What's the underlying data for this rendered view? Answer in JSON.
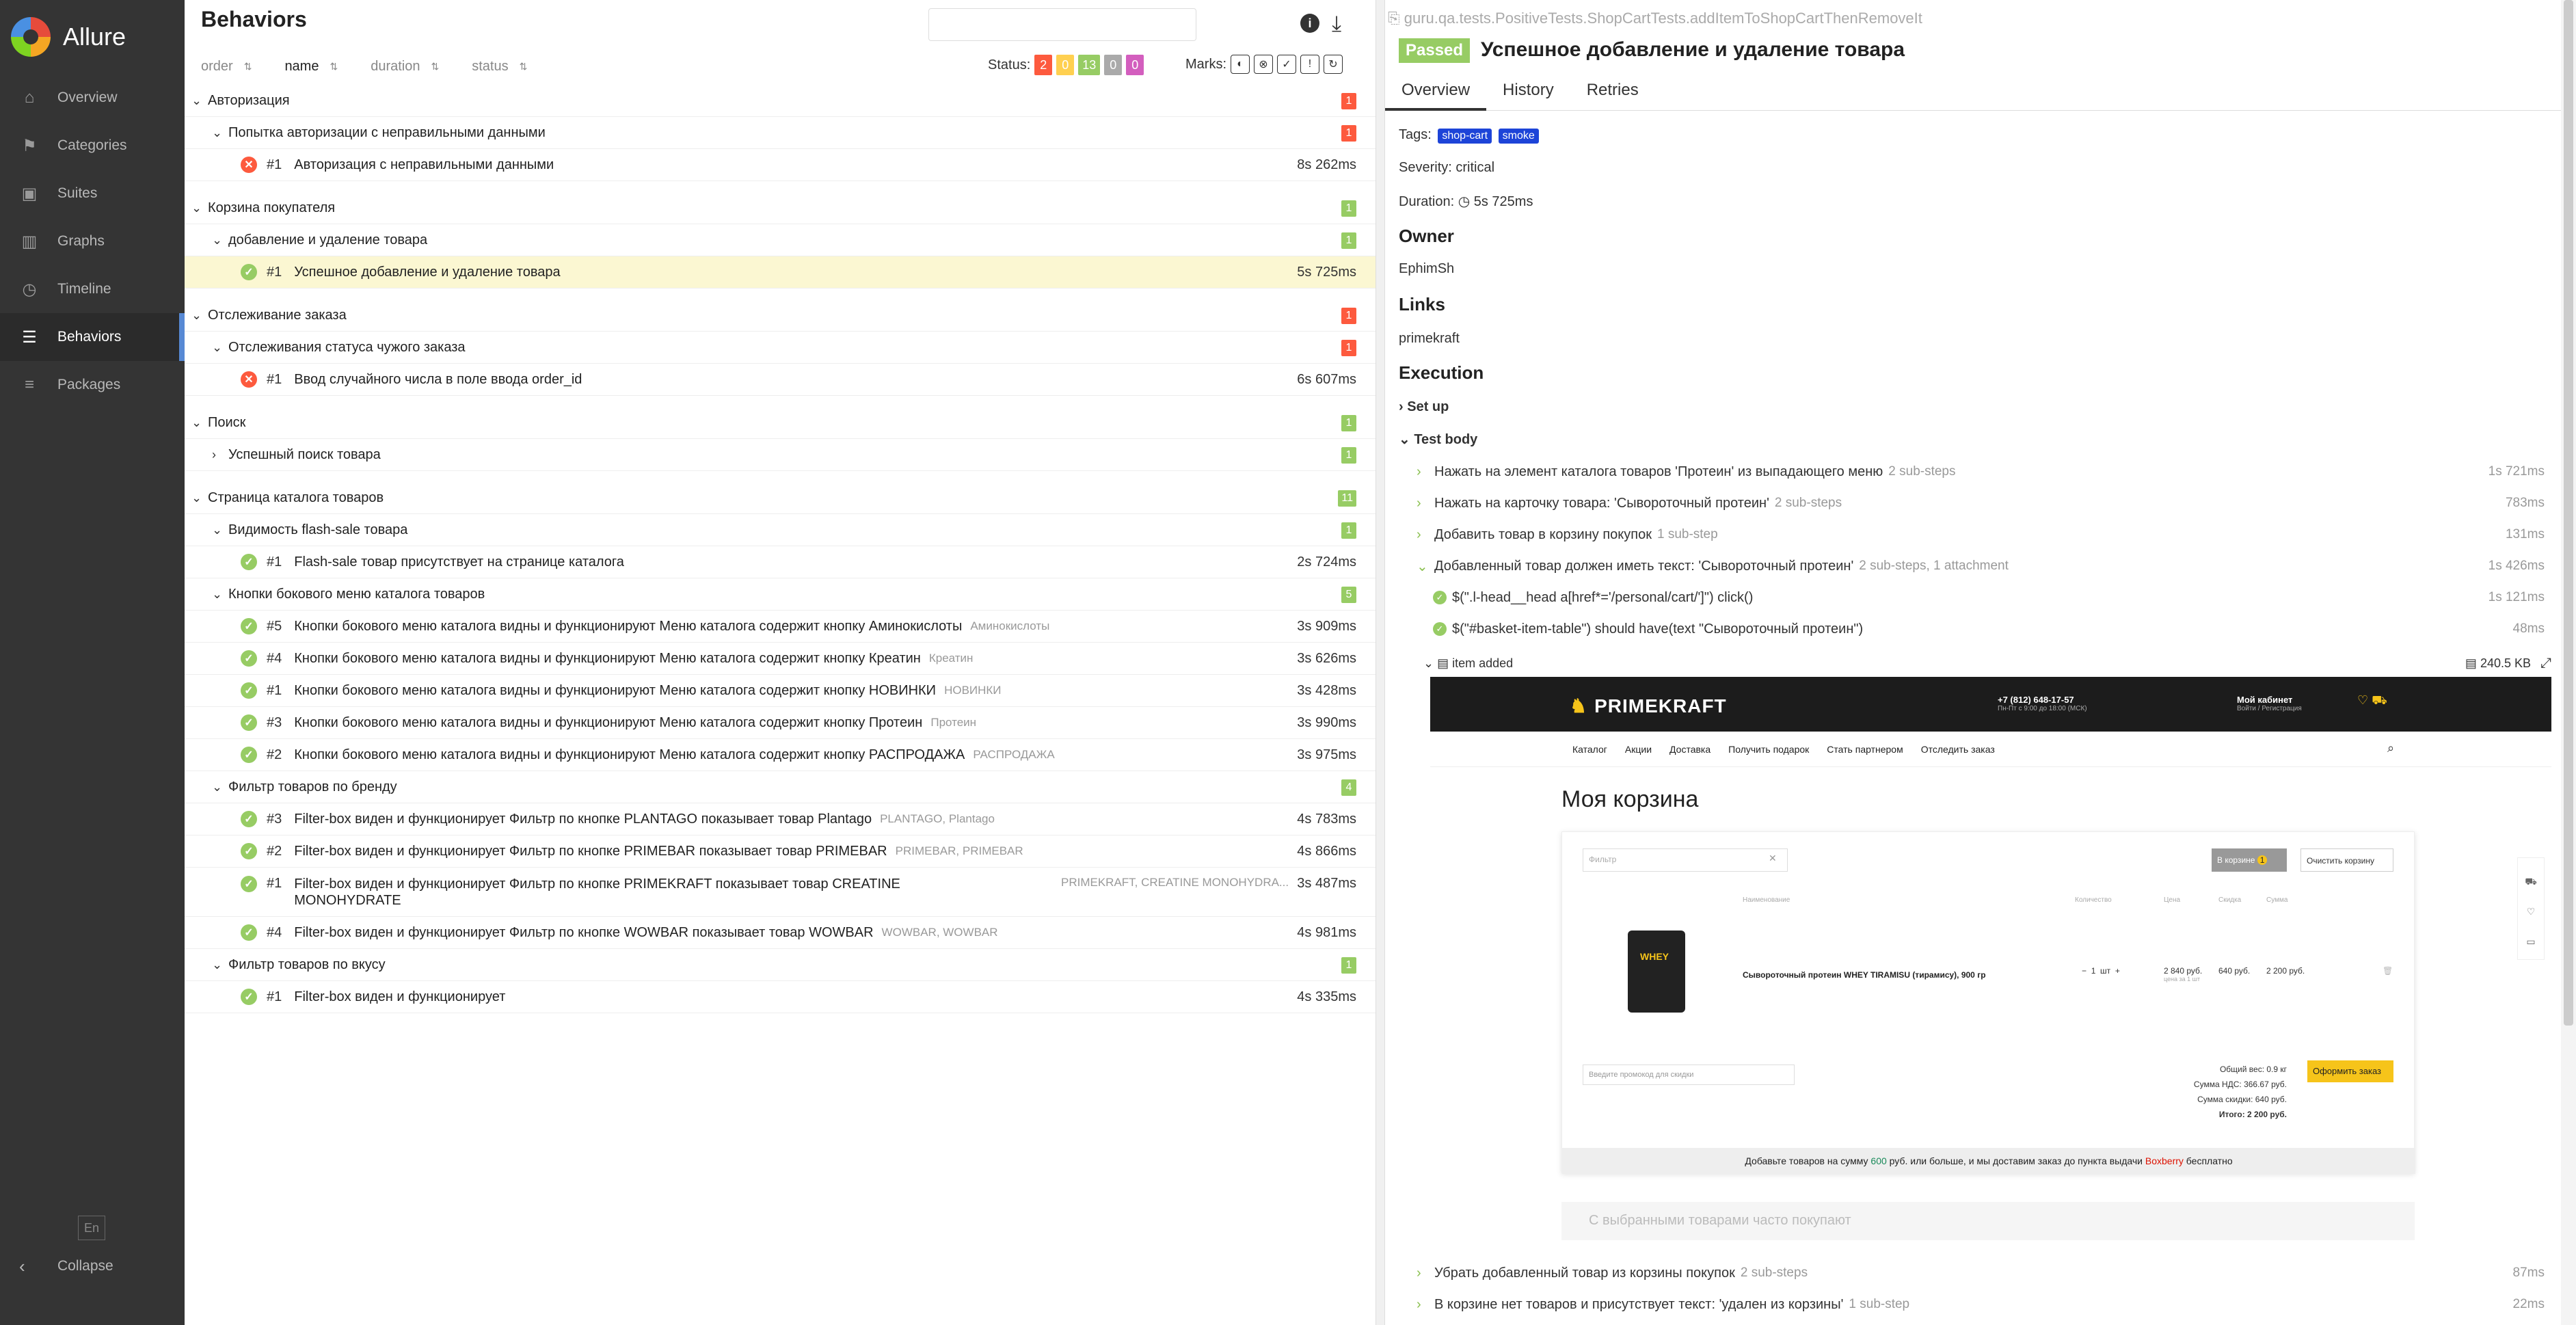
{
  "app": {
    "name": "Allure"
  },
  "sidebar": {
    "items": [
      {
        "label": "Overview",
        "icon": "home-icon"
      },
      {
        "label": "Categories",
        "icon": "flag-icon"
      },
      {
        "label": "Suites",
        "icon": "briefcase-icon"
      },
      {
        "label": "Graphs",
        "icon": "bar-chart-icon"
      },
      {
        "label": "Timeline",
        "icon": "clock-icon"
      },
      {
        "label": "Behaviors",
        "icon": "list-icon",
        "active": true
      },
      {
        "label": "Packages",
        "icon": "align-left-icon"
      }
    ],
    "lang": "En",
    "collapse": "Collapse"
  },
  "left": {
    "title": "Behaviors",
    "sort": {
      "order": "order",
      "name": "name",
      "duration": "duration",
      "status": "status"
    },
    "status_label": "Status:",
    "status_counts": {
      "failed": "2",
      "broken": "0",
      "passed": "13",
      "skipped": "0",
      "unknown": "0"
    },
    "marks_label": "Marks:",
    "tree": [
      {
        "type": "grp1",
        "name": "Авторизация",
        "count": "1",
        "color": "#fd5a3e"
      },
      {
        "type": "grp2",
        "name": "Попытка авторизации с неправильными данными",
        "count": "1",
        "color": "#fd5a3e"
      },
      {
        "type": "leaf",
        "status": "failed",
        "idx": "#1",
        "name": "Авторизация с неправильными данными",
        "params": "",
        "dur": "8s 262ms"
      },
      {
        "type": "gap"
      },
      {
        "type": "grp1",
        "name": "Корзина покупателя",
        "count": "1",
        "color": "#97cc64"
      },
      {
        "type": "grp2",
        "name": "добавление и удаление товара",
        "count": "1",
        "color": "#97cc64"
      },
      {
        "type": "leaf",
        "status": "passed",
        "idx": "#1",
        "name": "Успешное добавление и удаление товара",
        "params": "",
        "dur": "5s 725ms",
        "selected": true
      },
      {
        "type": "gap"
      },
      {
        "type": "grp1",
        "name": "Отслеживание заказа",
        "count": "1",
        "color": "#fd5a3e"
      },
      {
        "type": "grp2",
        "name": "Отслеживания статуса чужого заказа",
        "count": "1",
        "color": "#fd5a3e"
      },
      {
        "type": "leaf",
        "status": "failed",
        "idx": "#1",
        "name": "Ввод случайного числа в поле ввода order_id",
        "params": "",
        "dur": "6s 607ms"
      },
      {
        "type": "gap"
      },
      {
        "type": "grp1",
        "name": "Поиск",
        "count": "1",
        "color": "#97cc64"
      },
      {
        "type": "grp2c",
        "name": "Успешный поиск товара",
        "count": "1",
        "color": "#97cc64"
      },
      {
        "type": "gap"
      },
      {
        "type": "grp1",
        "name": "Страница каталога товаров",
        "count": "11",
        "color": "#97cc64"
      },
      {
        "type": "grp2",
        "name": "Видимость flash-sale товара",
        "count": "1",
        "color": "#97cc64"
      },
      {
        "type": "leaf",
        "status": "passed",
        "idx": "#1",
        "name": "Flash-sale товар присутствует на странице каталога",
        "params": "",
        "dur": "2s 724ms"
      },
      {
        "type": "grp2",
        "name": "Кнопки бокового меню каталога товаров",
        "count": "5",
        "color": "#97cc64"
      },
      {
        "type": "leaf",
        "status": "passed",
        "idx": "#5",
        "name": "Кнопки бокового меню каталога видны и функционируют Меню каталога содержит кнопку Аминокислоты",
        "params": "Аминокислоты",
        "dur": "3s 909ms"
      },
      {
        "type": "leaf",
        "status": "passed",
        "idx": "#4",
        "name": "Кнопки бокового меню каталога видны и функционируют Меню каталога содержит кнопку Креатин",
        "params": "Креатин",
        "dur": "3s 626ms"
      },
      {
        "type": "leaf",
        "status": "passed",
        "idx": "#1",
        "name": "Кнопки бокового меню каталога видны и функционируют Меню каталога содержит кнопку НОВИНКИ",
        "params": "НОВИНКИ",
        "dur": "3s 428ms"
      },
      {
        "type": "leaf",
        "status": "passed",
        "idx": "#3",
        "name": "Кнопки бокового меню каталога видны и функционируют Меню каталога содержит кнопку Протеин",
        "params": "Протеин",
        "dur": "3s 990ms"
      },
      {
        "type": "leaf",
        "status": "passed",
        "idx": "#2",
        "name": "Кнопки бокового меню каталога видны и функционируют Меню каталога содержит кнопку РАСПРОДАЖА",
        "params": "РАСПРОДАЖА",
        "dur": "3s 975ms"
      },
      {
        "type": "grp2",
        "name": "Фильтр товаров по бренду",
        "count": "4",
        "color": "#97cc64"
      },
      {
        "type": "leaf",
        "status": "passed",
        "idx": "#3",
        "name": "Filter-box виден и функционирует Фильтр по кнопке PLANTAGO показывает товар Plantago",
        "params": "PLANTAGO, Plantago",
        "dur": "4s 783ms"
      },
      {
        "type": "leaf",
        "status": "passed",
        "idx": "#2",
        "name": "Filter-box виден и функционирует Фильтр по кнопке PRIMEBAR показывает товар PRIMEBAR",
        "params": "PRIMEBAR, PRIMEBAR",
        "dur": "4s 866ms"
      },
      {
        "type": "leaf2",
        "status": "passed",
        "idx": "#1",
        "name": "Filter-box виден и функционирует Фильтр по кнопке PRIMEKRAFT показывает товар CREATINE MONOHYDRATE",
        "params": "PRIMEKRAFT, CREATINE MONOHYDRA...",
        "dur": "3s 487ms"
      },
      {
        "type": "leaf",
        "status": "passed",
        "idx": "#4",
        "name": "Filter-box виден и функционирует Фильтр по кнопке WOWBAR показывает товар WOWBAR",
        "params": "WOWBAR, WOWBAR",
        "dur": "4s 981ms"
      },
      {
        "type": "grp2",
        "name": "Фильтр товаров по вкусу",
        "count": "1",
        "color": "#97cc64"
      },
      {
        "type": "leaf",
        "status": "passed",
        "idx": "#1",
        "name": "Filter-box виден и функционирует",
        "params": "",
        "dur": "4s 335ms"
      }
    ]
  },
  "right": {
    "fullname": "guru.qa.tests.PositiveTests.ShopCartTests.addItemToShopCartThenRemoveIt",
    "status": "Passed",
    "title": "Успешное добавление и удаление товара",
    "tabs": [
      "Overview",
      "History",
      "Retries"
    ],
    "tags_label": "Tags:",
    "tags": [
      "shop-cart",
      "smoke"
    ],
    "severity": "Severity: critical",
    "duration_label": "Duration:",
    "duration": "5s 725ms",
    "owner_h": "Owner",
    "owner": "EphimSh",
    "links_h": "Links",
    "link": "primekraft",
    "execution_h": "Execution",
    "setup": "Set up",
    "testbody": "Test body",
    "steps": [
      {
        "name": "Нажать на элемент каталога товаров 'Протеин' из выпадающего меню",
        "sub": "2 sub-steps",
        "dur": "1s 721ms"
      },
      {
        "name": "Нажать на карточку товара: 'Сывороточный протеин'",
        "sub": "2 sub-steps",
        "dur": "783ms"
      },
      {
        "name": "Добавить товар в корзину покупок",
        "sub": "1 sub-step",
        "dur": "131ms"
      },
      {
        "name": "Добавленный товар должен иметь текст: 'Сывороточный протеин'",
        "sub": "2 sub-steps, 1 attachment",
        "dur": "1s 426ms"
      }
    ],
    "substeps": [
      {
        "name": "$(\".l-head__head a[href*='/personal/cart/']\") click()",
        "dur": "1s 121ms"
      },
      {
        "name": "$(\"#basket-item-table\") should have(text \"Сывороточный протеин\")",
        "dur": "48ms"
      }
    ],
    "attachment": {
      "name": "item added",
      "size": "240.5 KB"
    },
    "steps_after": [
      {
        "name": "Убрать добавленный товар из корзины покупок",
        "sub": "2 sub-steps",
        "dur": "87ms"
      },
      {
        "name": "В корзине нет товаров и присутствует текст: 'удален из корзины'",
        "sub": "1 sub-step",
        "dur": "22ms"
      }
    ]
  },
  "site": {
    "logo": "PRIMEKRAFT",
    "phone": "+7 (812) 648-17-57",
    "phone_sub": "Пн-Пт с 9:00 до 18:00 (МСК)",
    "account": "Мой кабинет",
    "account_sub": "Войти / Регистрация",
    "nav": [
      "Каталог",
      "Акции",
      "Доставка",
      "Получить подарок",
      "Стать партнером",
      "Отследить заказ"
    ],
    "cart_title": "Моя корзина",
    "filter_placeholder": "Фильтр",
    "in_cart": "В корзине",
    "in_cart_count": "1",
    "clear_cart": "Очистить корзину",
    "columns": [
      "Наименование",
      "Количество",
      "Цена",
      "Скидка",
      "Сумма"
    ],
    "product": "Сывороточный протеин WHEY TIRAMISU (тирамису), 900 гр",
    "qty": "1",
    "qty_unit": "шт",
    "price": "2 840 руб.",
    "price_sub": "цена за 1 шт",
    "discount": "640 руб.",
    "sum": "2 200 руб.",
    "promo": "Введите промокод для скидки",
    "weight": "Общий вес:  0.9 кг",
    "vat": "Сумма НДС:  366.67 руб.",
    "disc_total": "Сумма скидки:  640 руб.",
    "total": "Итого:  2 200 руб.",
    "order_btn": "Оформить заказ",
    "delivery_a": "Добавьте товаров на сумму ",
    "delivery_amount": "600",
    "delivery_b": " руб. или больше, и мы доставим заказ до пункта выдачи ",
    "delivery_brand": "Boxberry",
    "delivery_c": " бесплатно",
    "also": "С выбранными товарами часто покупают"
  }
}
